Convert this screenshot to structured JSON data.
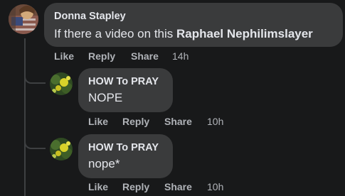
{
  "comments": [
    {
      "author": "Donna Stapley",
      "text_prefix": "If there a video on this ",
      "mention": "Raphael Nephilimslayer",
      "actions": {
        "like": "Like",
        "reply": "Reply",
        "share": "Share",
        "time": "14h"
      }
    },
    {
      "author": "HOW To PRAY",
      "text": "NOPE",
      "actions": {
        "like": "Like",
        "reply": "Reply",
        "share": "Share",
        "time": "10h"
      }
    },
    {
      "author": "HOW To PRAY",
      "text": "nope*",
      "actions": {
        "like": "Like",
        "reply": "Reply",
        "share": "Share",
        "time": "10h"
      }
    }
  ],
  "colors": {
    "background": "#18191a",
    "bubble": "#3a3b3c",
    "text_primary": "#e4e6eb",
    "text_secondary": "#b0b3b8"
  }
}
